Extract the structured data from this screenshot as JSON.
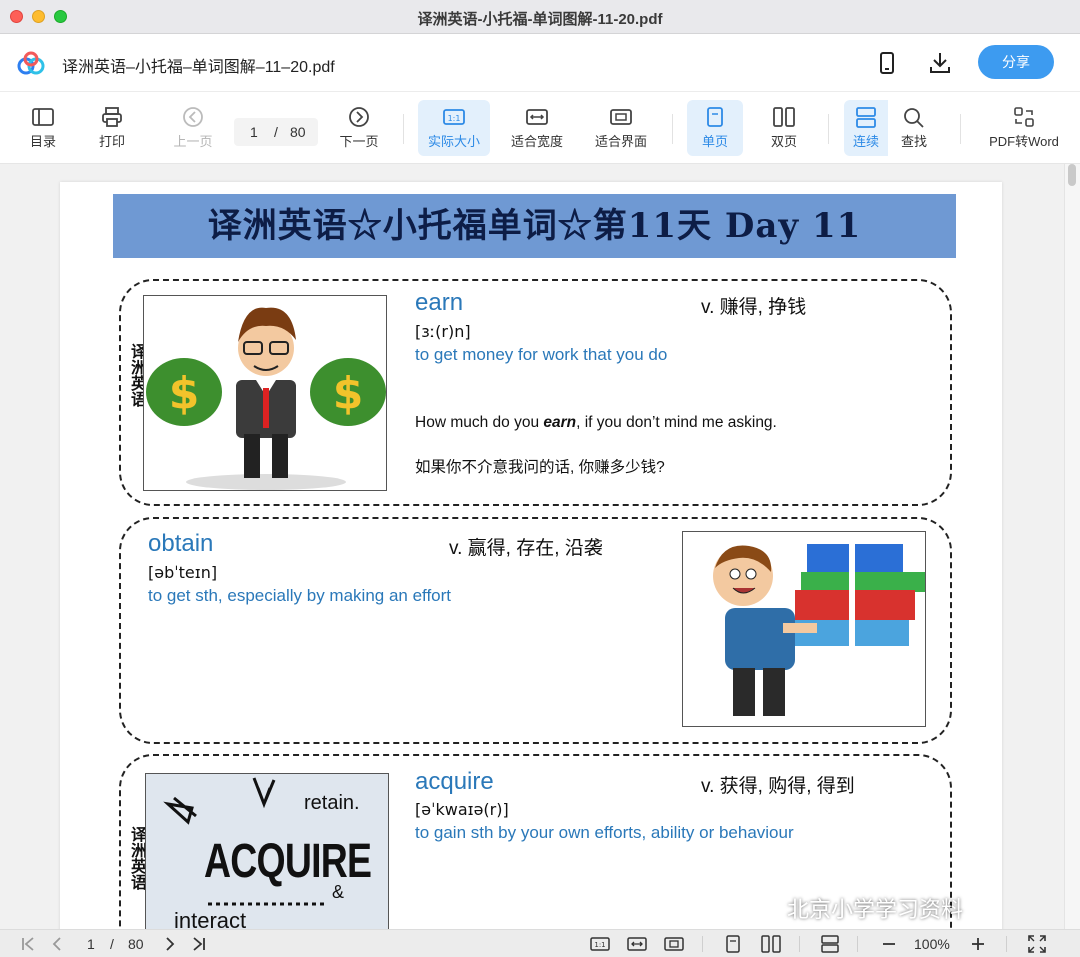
{
  "window": {
    "title": "译洲英语-小托福-单词图解-11-20.pdf"
  },
  "header": {
    "doc_name": "译洲英语–小托福–单词图解–11–20.pdf",
    "share_label": "分享"
  },
  "toolbar": {
    "toc": "目录",
    "print": "打印",
    "prev": "上一页",
    "page_current": "1",
    "page_sep": "/",
    "page_total": "80",
    "next": "下一页",
    "actual_size": "实际大小",
    "fit_width": "适合宽度",
    "fit_page": "适合界面",
    "single": "单页",
    "double": "双页",
    "continuous": "连续",
    "find": "查找",
    "pdf_to_word": "PDF转Word"
  },
  "document": {
    "banner": "译洲英语☆小托福单词☆第11天 Day 11",
    "side_label": "译洲英语",
    "entries": [
      {
        "word": "earn",
        "pos": "v. 赚得, 挣钱",
        "ipa": "[ɜː(r)n]",
        "definition": "to get money for work that you do",
        "example_before": "How much do you ",
        "example_word": "earn",
        "example_after": ", if you don’t mind me asking.",
        "example_cn": "如果你不介意我问的话, 你赚多少钱?"
      },
      {
        "word": "obtain",
        "pos": "v. 赢得, 存在, 沿袭",
        "ipa": "[əbˈteɪn]",
        "definition": "to get sth, especially by making an effort"
      },
      {
        "word": "acquire",
        "pos": "v. 获得, 购得, 得到",
        "ipa": "[əˈkwaɪə(r)]",
        "definition": "to gain sth by your own efforts, ability or behaviour",
        "art_words": [
          "retain.",
          "ACQUIRE",
          "&",
          "interact"
        ]
      }
    ]
  },
  "bottombar": {
    "page_current": "1",
    "page_sep": "/",
    "page_total": "80",
    "zoom": "100%"
  },
  "watermark": "北京小学学习资料",
  "colors": {
    "accent": "#3d9bf0",
    "banner": "#6f99d3",
    "word": "#2a78b9",
    "active_bg": "#e3f0fc"
  }
}
